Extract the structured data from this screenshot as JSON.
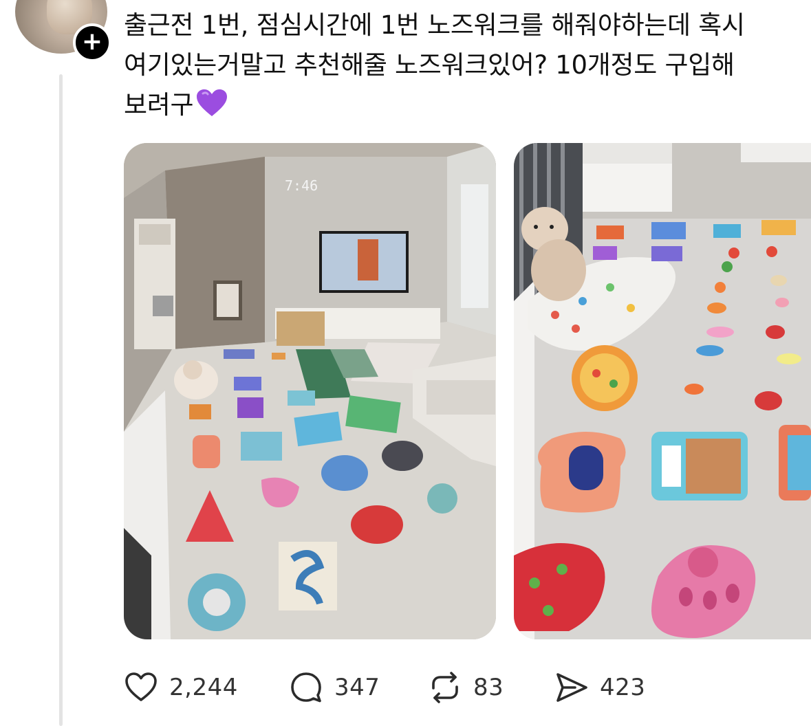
{
  "post": {
    "text": "출근전 1번, 점심시간에 1번 노즈워크를 해줘야하는데 혹시\n여기있는거말고 추천해줄 노즈워크있어? 10개정도 구입해\n보려구",
    "emoji": "purple-heart"
  },
  "media": {
    "photo1_clock": "7:46"
  },
  "actions": {
    "likes": "2,244",
    "replies": "347",
    "reposts": "83",
    "shares": "423"
  },
  "colors": {
    "accent_heart": "#9b4de0",
    "icon": "#2b2b2b",
    "thread_line": "#e3e3e3"
  }
}
